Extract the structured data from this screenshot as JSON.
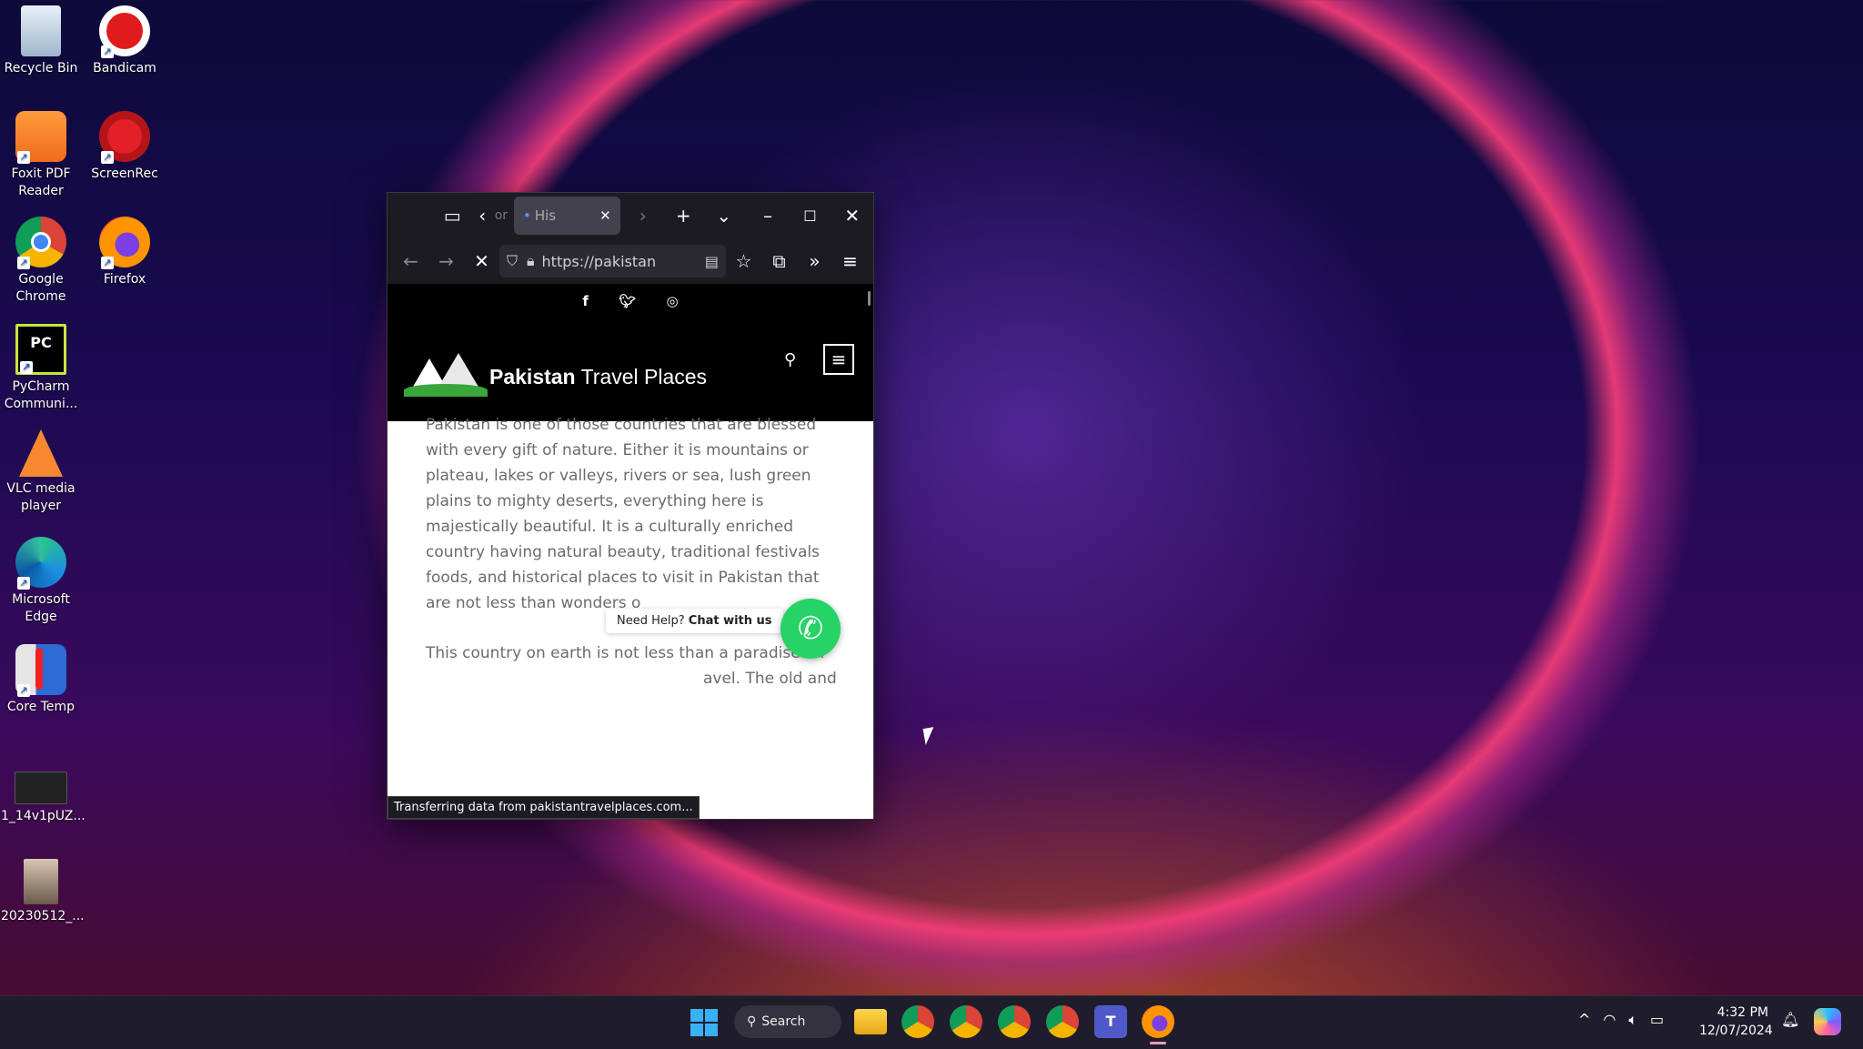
{
  "desktop_icons": [
    {
      "label": "Recycle Bin",
      "icon": "recycle-bin-icon"
    },
    {
      "label": "Bandicam",
      "icon": "bandicam-icon"
    },
    {
      "label": "Foxit PDF Reader",
      "icon": "foxit-pdf-icon"
    },
    {
      "label": "ScreenRec",
      "icon": "screenrec-icon"
    },
    {
      "label": "Google Chrome",
      "icon": "chrome-icon"
    },
    {
      "label": "Firefox",
      "icon": "firefox-icon"
    },
    {
      "label": "PyCharm Communi...",
      "icon": "pycharm-icon"
    },
    {
      "label": "VLC media player",
      "icon": "vlc-icon"
    },
    {
      "label": "Microsoft Edge",
      "icon": "edge-icon"
    },
    {
      "label": "Core Temp",
      "icon": "core-temp-icon"
    },
    {
      "label": "1_14v1pUZ...",
      "icon": "image-file-icon"
    },
    {
      "label": "20230512_...",
      "icon": "photo-file-icon"
    }
  ],
  "browser": {
    "prev_tab_label": "or",
    "active_tab_label": "His",
    "url": "https://pakistan",
    "status_text": "Transferring data from pakistantravelplaces.com..."
  },
  "site": {
    "brand_bold": "Pakistan",
    "brand_rest": " Travel Places",
    "paragraph1": "Pakistan is one of those countries that are blessed with every gift of nature. Either it is mountains or plateau, lakes or valleys, rivers or sea, lush green plains to mighty deserts, everything here is majestically beautiful. It is a culturally enriched country having natural beauty, traditional festivals foods, and historical places to visit in Pakistan that are not less than wonders o",
    "paragraph2": "This country on earth is not less than a paradise for",
    "paragraph2_line2": "avel. The old and",
    "chat_prefix": "Need Help? ",
    "chat_bold": "Chat with us"
  },
  "taskbar": {
    "search_label": "Search",
    "time": "4:32 PM",
    "date": "12/07/2024"
  }
}
